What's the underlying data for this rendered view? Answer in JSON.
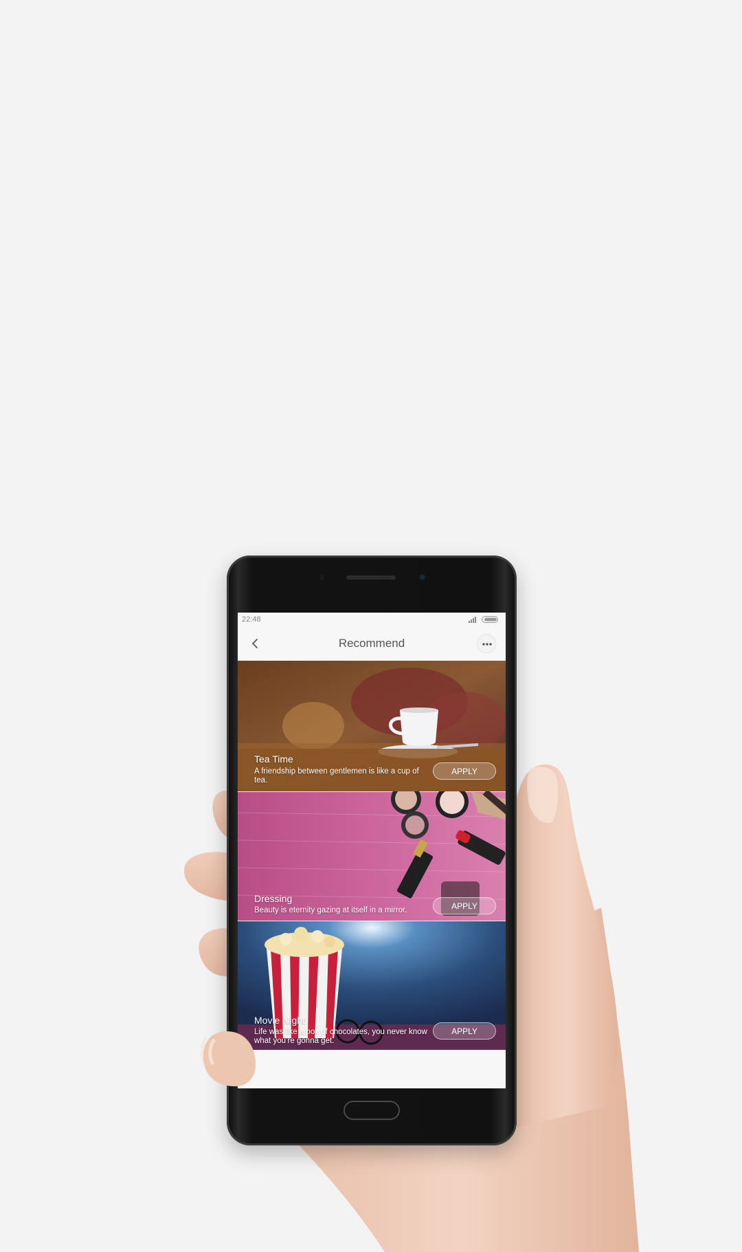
{
  "status_bar": {
    "time": "22:48"
  },
  "header": {
    "title": "Recommend"
  },
  "themes": [
    {
      "title": "Tea Time",
      "description": "A friendship between gentlemen is like a cup of tea.",
      "apply_label": "APPLY"
    },
    {
      "title": "Dressing",
      "description": "Beauty is eternity gazing at itself in a mirror.",
      "apply_label": "APPLY"
    },
    {
      "title": "Movie Night",
      "description": "Life was like a box of chocolates, you never know what you’re gonna get.",
      "apply_label": "APPLY"
    }
  ],
  "colors": {
    "page_background": "#f3f3f3",
    "tea_band": "#8a5424",
    "dressing_pink": "#c85a94",
    "movie_blue": "#2a4d7a",
    "next_teal": "#4fa7a3"
  },
  "icons": {
    "back": "chevron-left-icon",
    "more": "more-dots-icon",
    "signal": "signal-icon",
    "battery": "battery-icon"
  }
}
